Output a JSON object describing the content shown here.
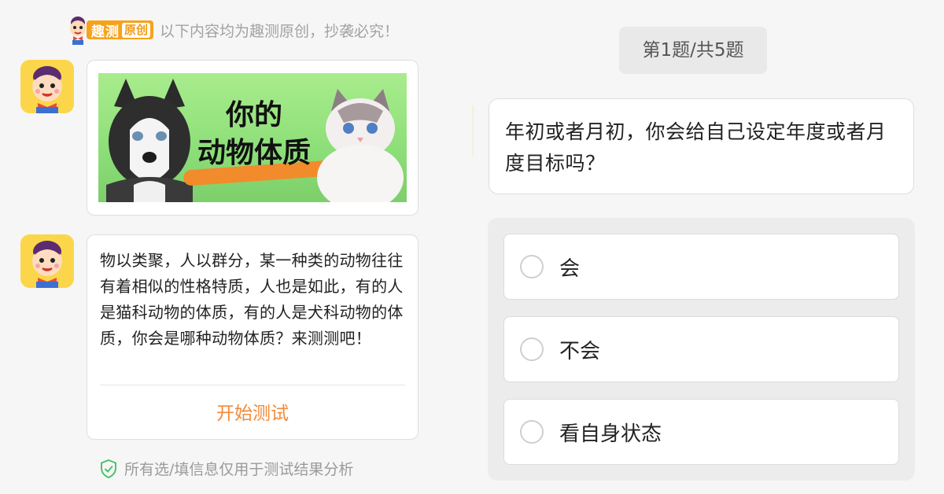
{
  "brand": {
    "name": "趣测",
    "tag": "原创",
    "notice": "以下内容均为趣测原创，抄袭必究！"
  },
  "banner": {
    "title_line1": "你的",
    "title_line2": "动物体质"
  },
  "intro": {
    "description": "物以类聚，人以群分，某一种类的动物往往有着相似的性格特质，人也是如此，有的人是猫科动物的体质，有的人是犬科动物的体质，你会是哪种动物体质？来测测吧！",
    "start_label": "开始测试"
  },
  "privacy": {
    "text": "所有选/填信息仅用于测试结果分析",
    "icon": "shield-check-icon"
  },
  "quiz": {
    "progress": "第1题/共5题",
    "question": "年初或者月初，你会给自己设定年度或者月度目标吗？",
    "options": [
      {
        "label": "会"
      },
      {
        "label": "不会"
      },
      {
        "label": "看自身状态"
      }
    ]
  },
  "colors": {
    "accent_orange": "#f28a3a",
    "brand_yellow": "#f7a21b",
    "banner_green": "#8fe07a",
    "avatar_yellow": "#fcd64a",
    "shield_green": "#4cc26a"
  }
}
